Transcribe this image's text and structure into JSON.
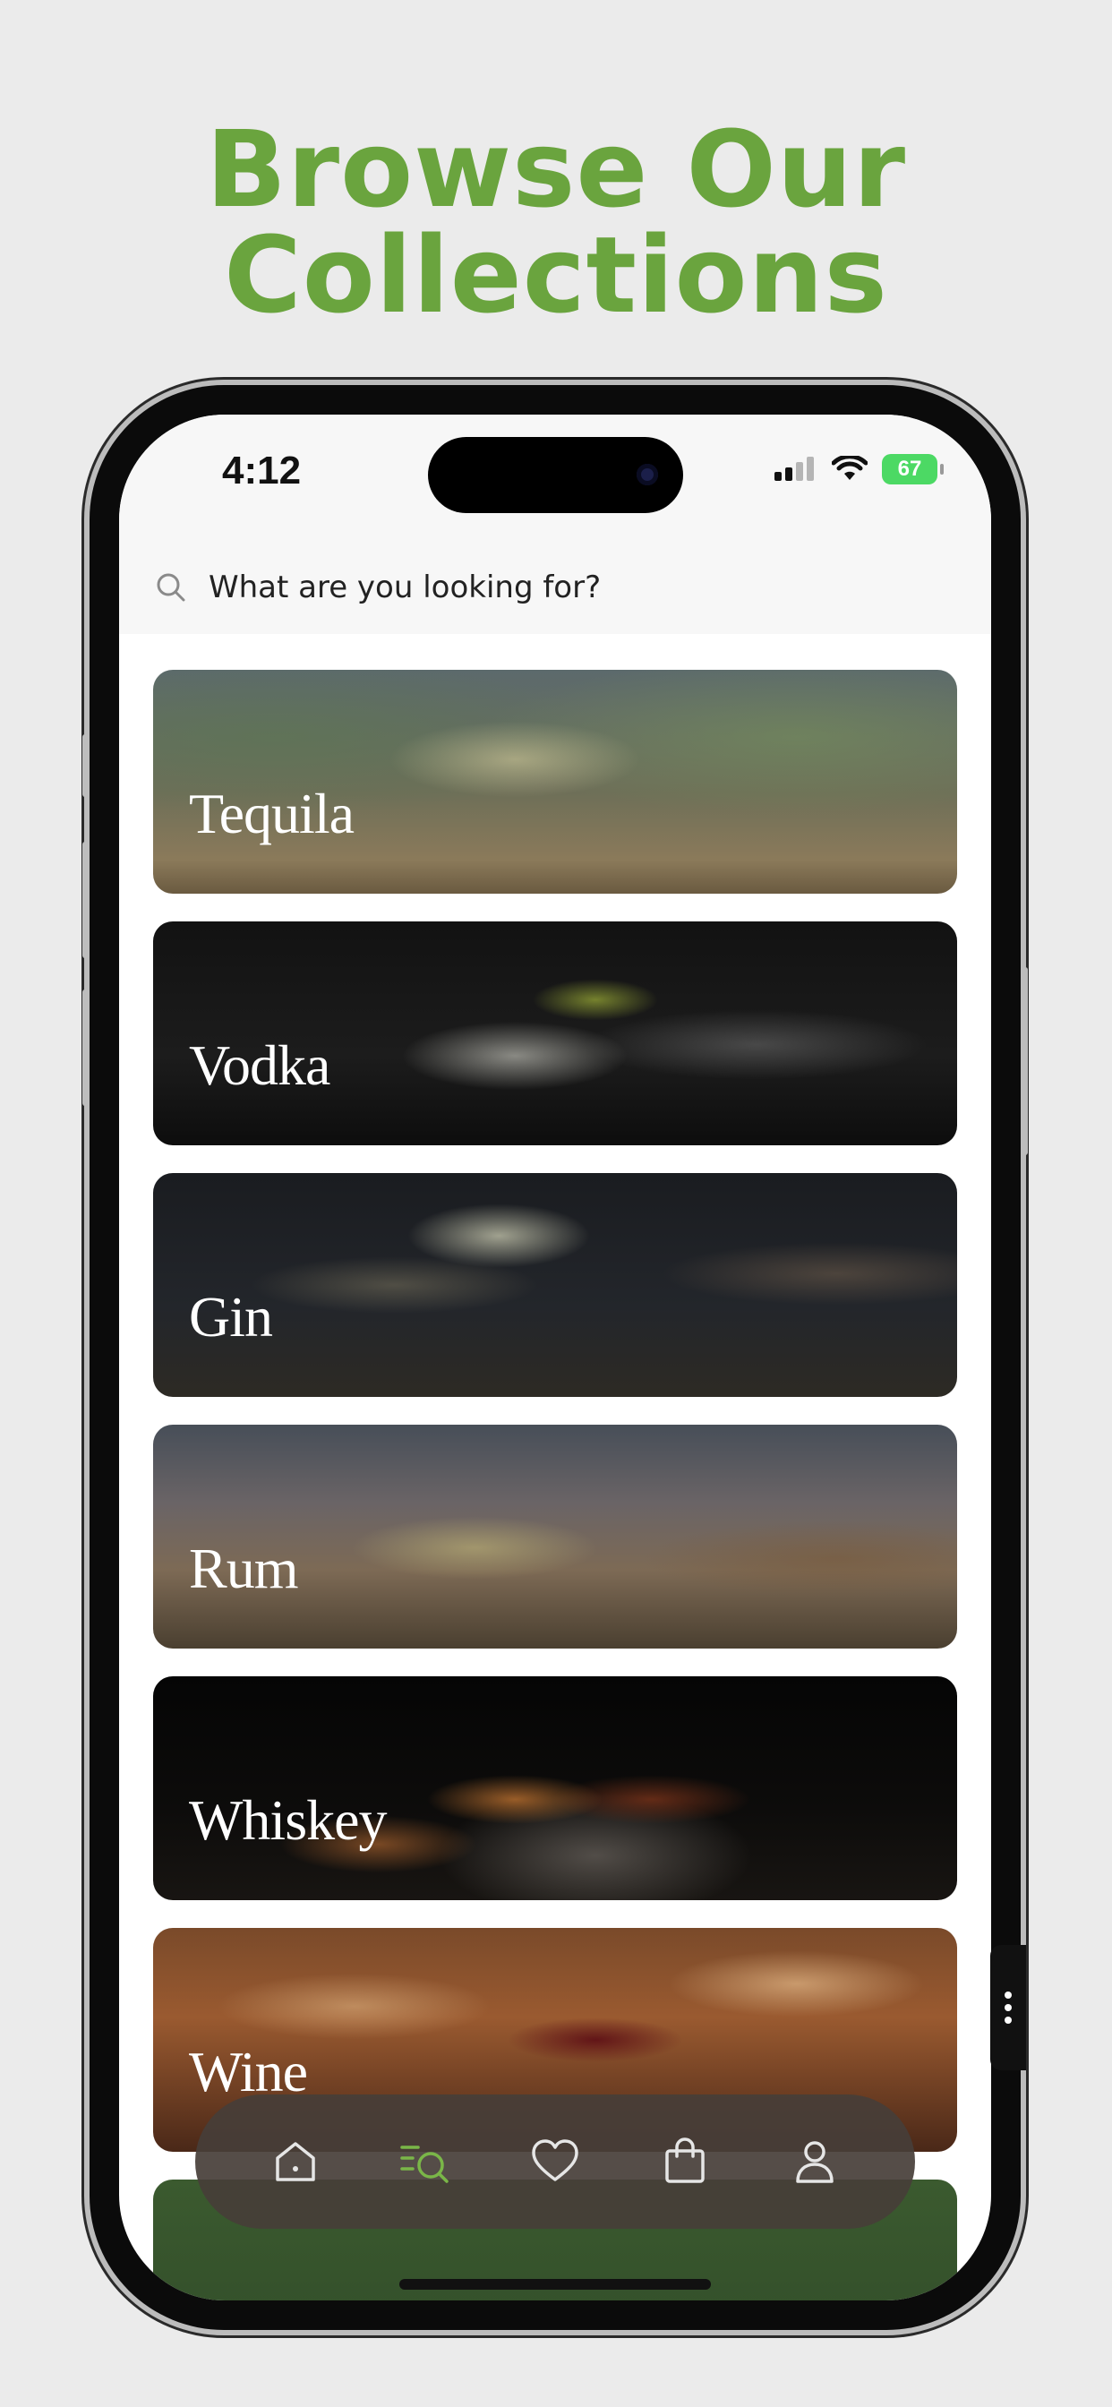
{
  "headline": {
    "line1": "Browse Our",
    "line2": "Collections"
  },
  "status_bar": {
    "time": "4:12",
    "battery": "67"
  },
  "search": {
    "placeholder": "What are you looking for?"
  },
  "collections": [
    {
      "label": "Tequila"
    },
    {
      "label": "Vodka"
    },
    {
      "label": "Gin"
    },
    {
      "label": "Rum"
    },
    {
      "label": "Whiskey"
    },
    {
      "label": "Wine"
    }
  ],
  "tab_bar": {
    "items": [
      {
        "icon": "home-icon",
        "active": false
      },
      {
        "icon": "browse-search-icon",
        "active": true
      },
      {
        "icon": "heart-icon",
        "active": false
      },
      {
        "icon": "shopping-bag-icon",
        "active": false
      },
      {
        "icon": "profile-icon",
        "active": false
      }
    ]
  },
  "colors": {
    "accent": "#6aa43e",
    "tab_active": "#7ab648",
    "tab_inactive": "#e6e6e6"
  }
}
